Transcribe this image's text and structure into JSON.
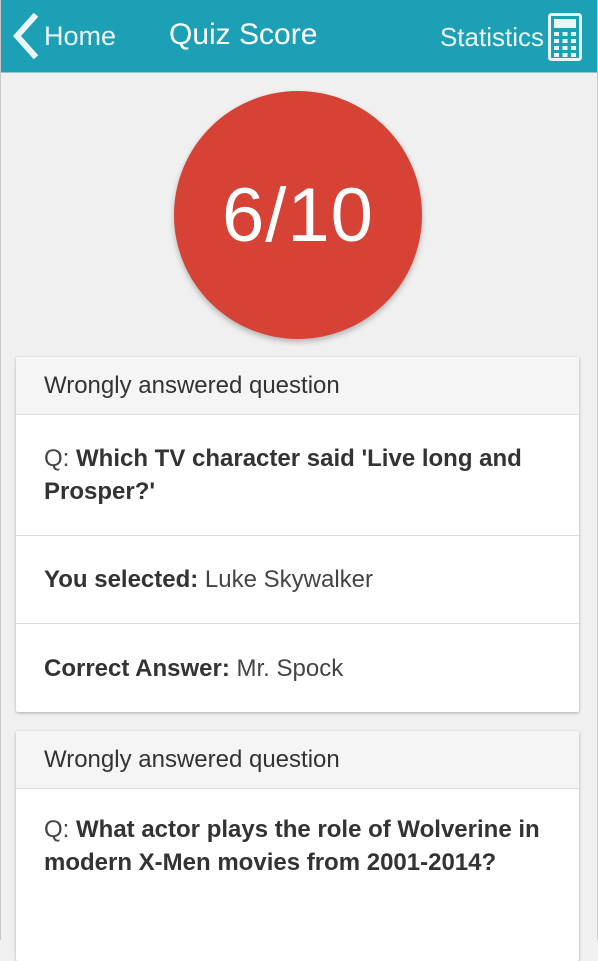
{
  "header": {
    "back_label": "Home",
    "title": "Quiz Score",
    "stats_label": "Statistics",
    "back_icon": "chevron-left-icon",
    "stats_icon": "calculator-icon"
  },
  "score": {
    "text": "6/10",
    "color": "#d64235"
  },
  "colors": {
    "toolbar": "#1ca0b5",
    "background": "#f0f0f0"
  },
  "wrong_answers": [
    {
      "header": "Wrongly answered question",
      "q_prefix": "Q: ",
      "question": "Which TV character said 'Live long and Prosper?'",
      "selected_label": "You selected:",
      "selected_value": " Luke Skywalker",
      "correct_label": "Correct Answer:",
      "correct_value": " Mr. Spock"
    },
    {
      "header": "Wrongly answered question",
      "q_prefix": "Q: ",
      "question": "What actor plays the role of Wolverine in modern X-Men movies from 2001-2014?"
    }
  ]
}
